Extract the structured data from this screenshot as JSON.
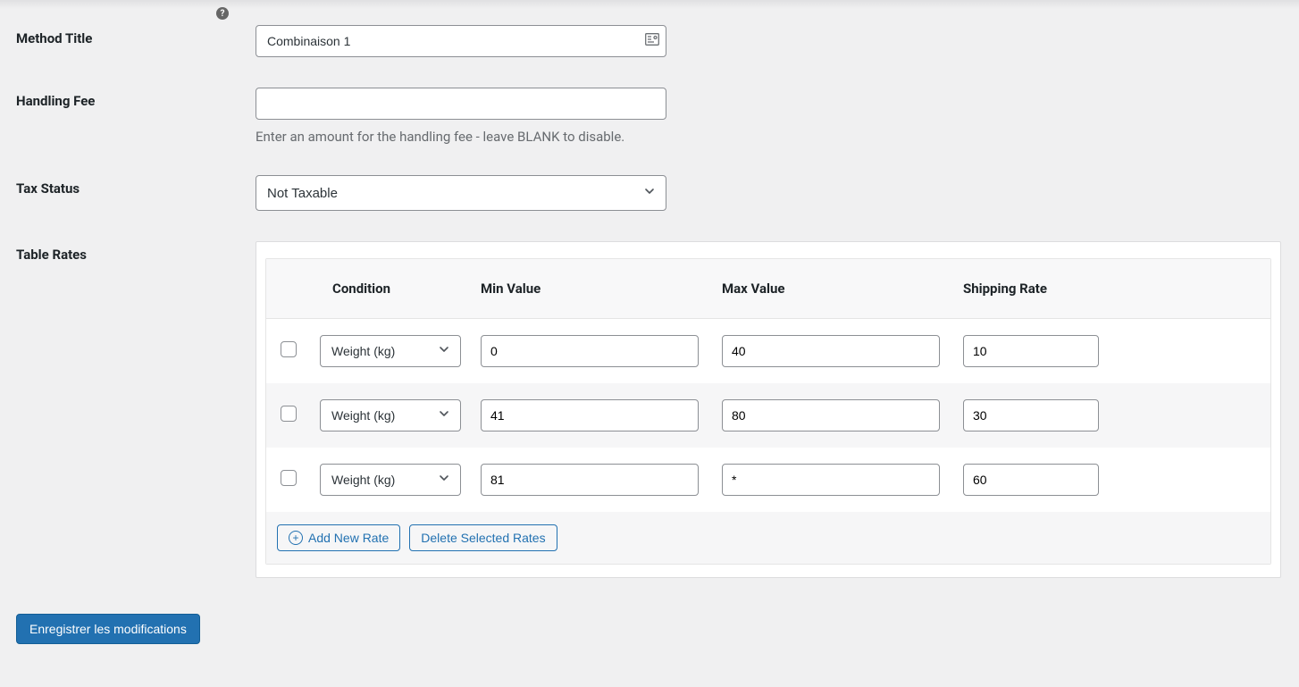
{
  "labels": {
    "method_title": "Method Title",
    "handling_fee": "Handling Fee",
    "tax_status": "Tax Status",
    "table_rates": "Table Rates"
  },
  "method_title": {
    "value": "Combinaison 1"
  },
  "handling_fee": {
    "value": "",
    "description": "Enter an amount for the handling fee - leave BLANK to disable."
  },
  "tax_status": {
    "selected": "Not Taxable"
  },
  "table": {
    "headers": {
      "condition": "Condition",
      "min": "Min Value",
      "max": "Max Value",
      "rate": "Shipping Rate"
    },
    "rows": [
      {
        "condition": "Weight (kg)",
        "min": "0",
        "max": "40",
        "rate": "10"
      },
      {
        "condition": "Weight (kg)",
        "min": "41",
        "max": "80",
        "rate": "30"
      },
      {
        "condition": "Weight (kg)",
        "min": "81",
        "max": "*",
        "rate": "60"
      }
    ],
    "actions": {
      "add": "Add New Rate",
      "delete": "Delete Selected Rates"
    }
  },
  "save_button": "Enregistrer les modifications",
  "help_icon_char": "?"
}
